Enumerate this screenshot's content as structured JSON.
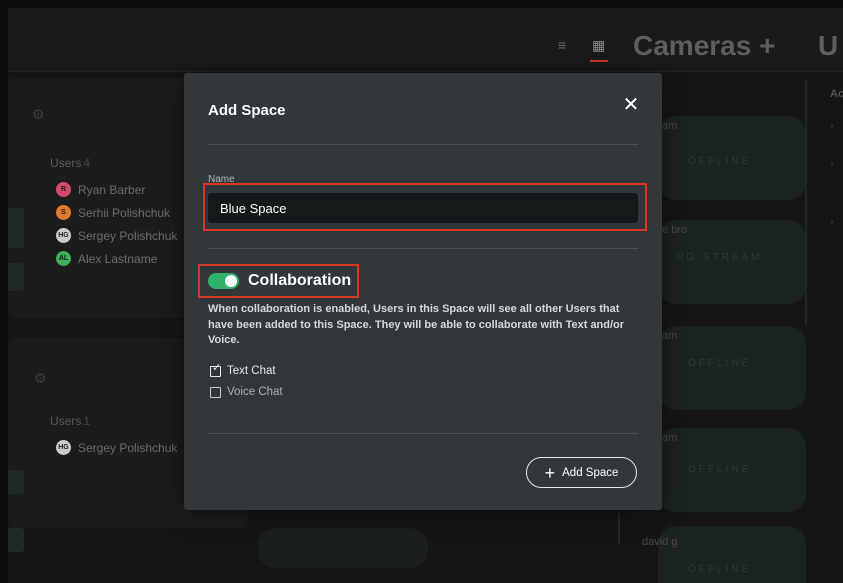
{
  "header": {
    "list_view_icon": "list-icon",
    "grid_view_icon": "grid-icon",
    "cameras_title": "Cameras +",
    "users_title_partial": "U"
  },
  "spaces": [
    {
      "gear_icon": "gear-icon",
      "users_label": "Users",
      "users_count": "4",
      "users": [
        {
          "initials": "R",
          "name": "Ryan Barber",
          "color": "#d44a6b"
        },
        {
          "initials": "S",
          "name": "Serhii Polishchuk",
          "color": "#e07a2e"
        },
        {
          "initials": "HG",
          "name": "Sergey Polishchuk",
          "color": "#cccccc"
        },
        {
          "initials": "AL",
          "name": "Alex Lastname",
          "color": "#3fae5a"
        }
      ]
    },
    {
      "gear_icon": "gear-icon",
      "users_label": "Users",
      "users_count": "1",
      "users": [
        {
          "initials": "HG",
          "name": "Sergey Polishchuk",
          "color": "#cccccc"
        }
      ]
    }
  ],
  "cameras": [
    {
      "name": "am",
      "status": "OFFLINE"
    },
    {
      "name": "e bro",
      "status": "NO STREAM"
    },
    {
      "name": "am",
      "status": "OFFLINE"
    },
    {
      "name": "am",
      "status": "OFFLINE"
    },
    {
      "name": "david g",
      "status": "OFFLINE"
    }
  ],
  "right_panel": {
    "label": "Ac"
  },
  "modal": {
    "title": "Add Space",
    "close_icon": "close-icon",
    "name_label": "Name",
    "name_value": "Blue Space",
    "collaboration_title": "Collaboration",
    "collaboration_enabled": true,
    "collaboration_description": "When collaboration is enabled, Users in this Space will see all other Users that have been added to this Space. They will be able to collaborate with Text and/or Voice.",
    "options": [
      {
        "label": "Text Chat",
        "checked": true
      },
      {
        "label": "Voice Chat",
        "checked": false
      }
    ],
    "submit_label": "Add Space",
    "submit_icon": "plus-icon"
  },
  "colors": {
    "accent_green": "#2fb36b",
    "highlight_red": "#d63a20",
    "modal_bg": "#31373a",
    "input_bg": "#16191a"
  }
}
